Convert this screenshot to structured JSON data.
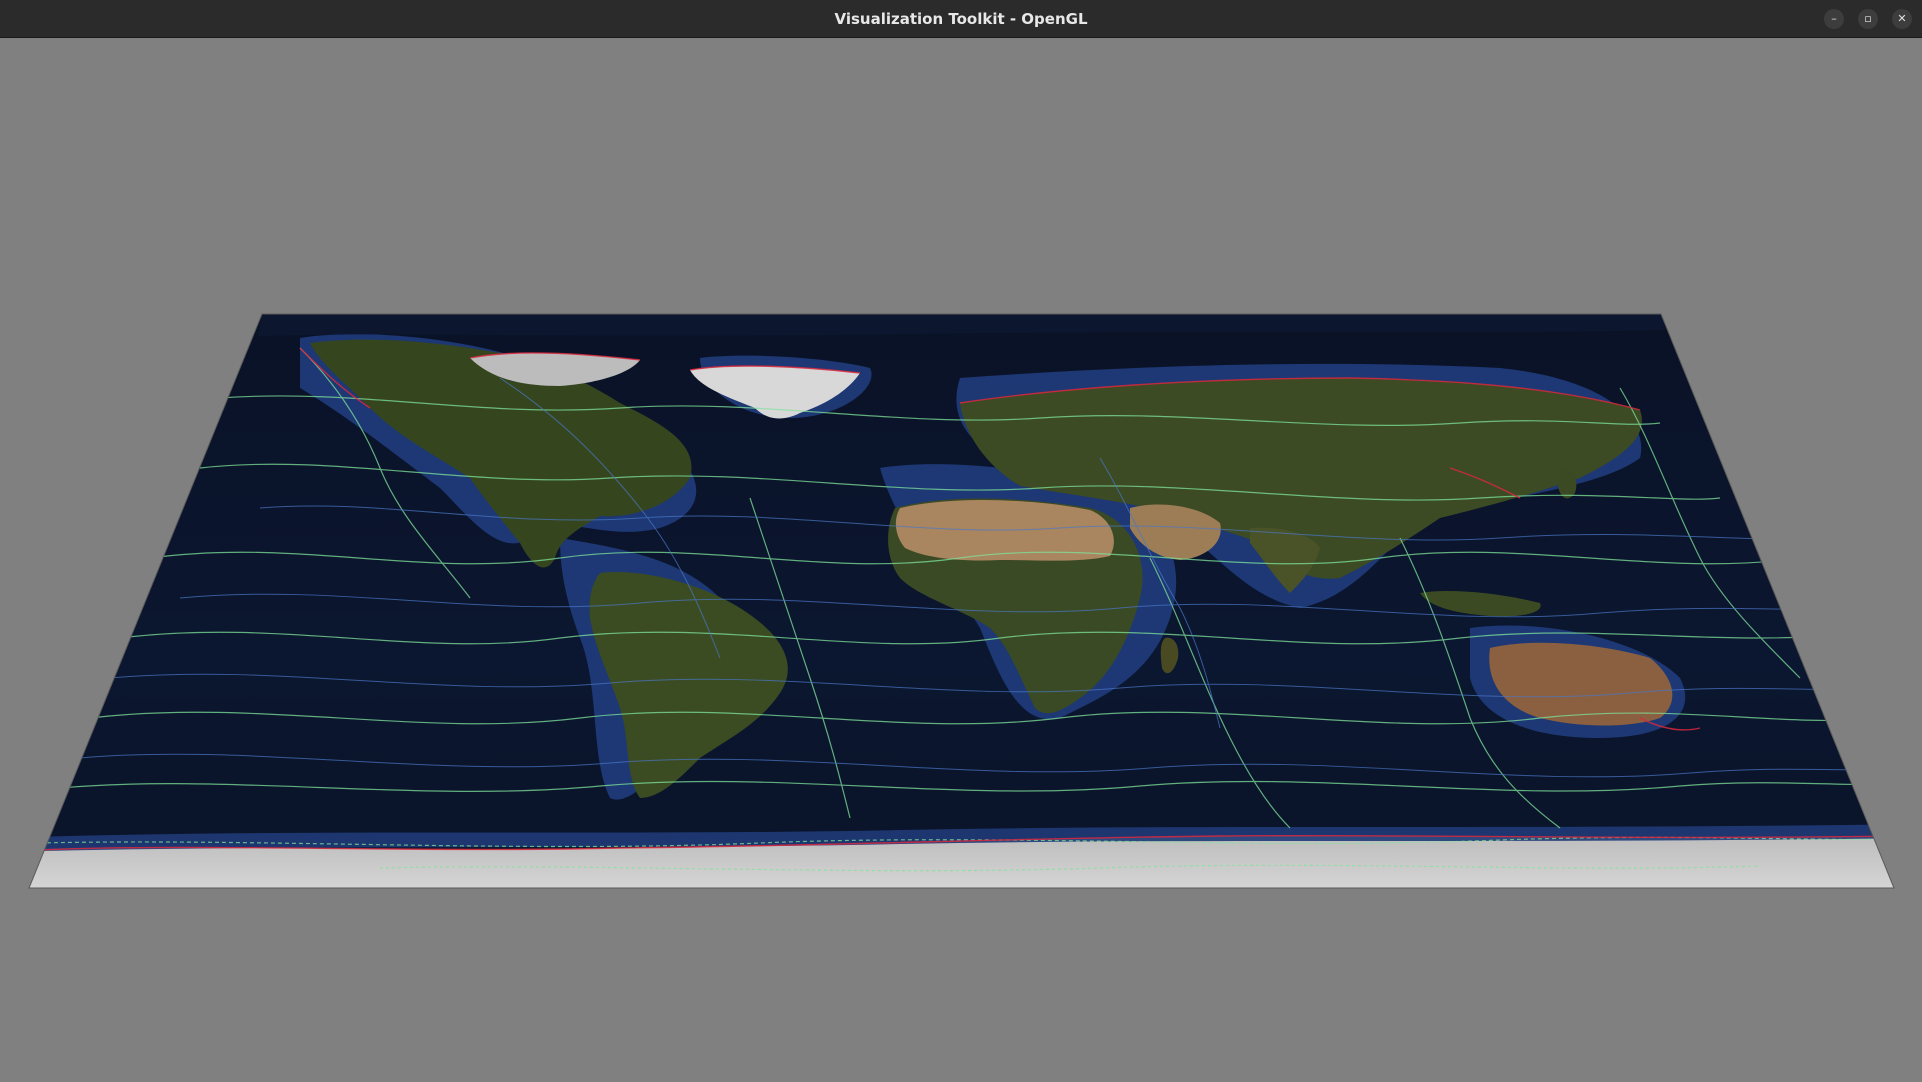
{
  "window": {
    "title": "Visualization Toolkit - OpenGL",
    "controls": {
      "minimize_glyph": "–",
      "maximize_glyph": "▫",
      "close_glyph": "✕"
    }
  },
  "render_view": {
    "background_color": "#808080",
    "content": "world-map-texture-plane",
    "ocean_color": "#0b1428",
    "shelf_color": "#1f3a78",
    "land_color": "#3a4a26",
    "desert_color": "#b08a5e",
    "ice_color": "#cfcfcf",
    "contour_colors": [
      "#7fe39a",
      "#4a78c8",
      "#d8283c"
    ]
  }
}
